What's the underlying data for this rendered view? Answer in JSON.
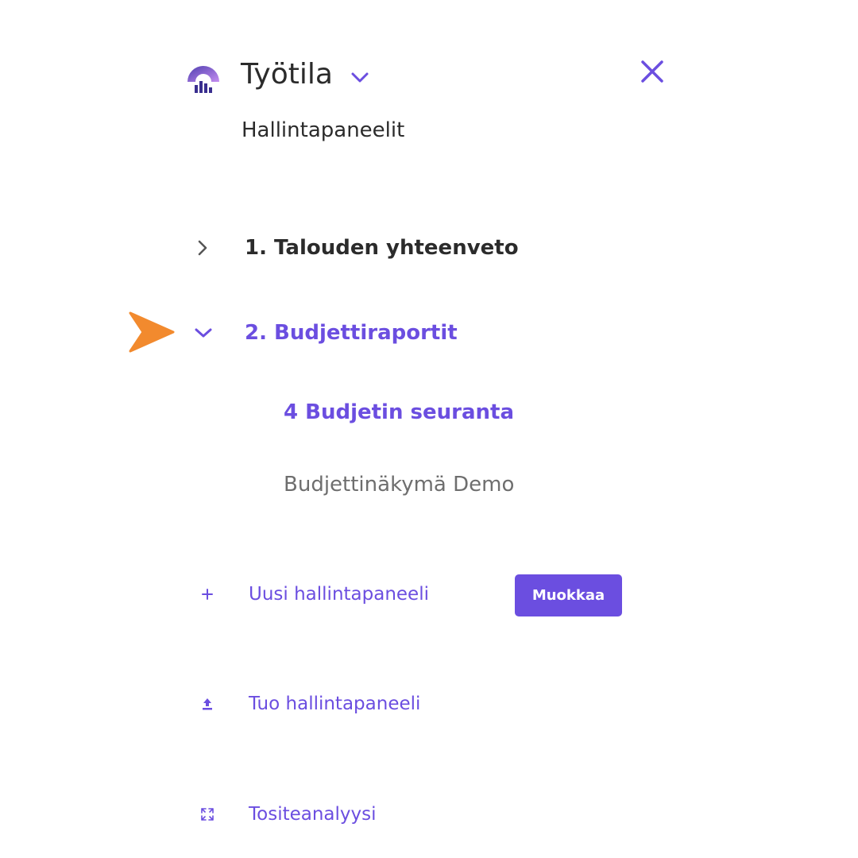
{
  "header": {
    "workspace_title": "Työtila",
    "section_subtitle": "Hallintapaneelit"
  },
  "tree": {
    "items": [
      {
        "label": "1. Talouden yhteenveto",
        "expanded": false
      },
      {
        "label": "2. Budjettiraportit",
        "expanded": true,
        "children": [
          {
            "label": "4 Budjetin seuranta",
            "active": true
          },
          {
            "label": "Budjettinäkymä Demo",
            "active": false
          }
        ]
      }
    ]
  },
  "actions": {
    "new_dashboard": "Uusi hallintapaneeli",
    "edit_button": "Muokkaa",
    "import_dashboard": "Tuo hallintapaneeli",
    "voucher_analysis": "Tositeanalyysi"
  },
  "icons": {
    "logo": "workspace-logo-icon",
    "workspace_dropdown": "chevron-down-icon",
    "close": "close-icon",
    "collapsed": "chevron-right-icon",
    "expanded": "chevron-down-icon",
    "pointer": "pointer-arrow-icon",
    "new": "plus-icon",
    "import": "upload-icon",
    "analysis": "expand-icon"
  },
  "colors": {
    "accent": "#6b4ee0",
    "text_primary": "#2b2b2b",
    "text_muted": "#6e6e6e",
    "pointer": "#f28a2e"
  }
}
